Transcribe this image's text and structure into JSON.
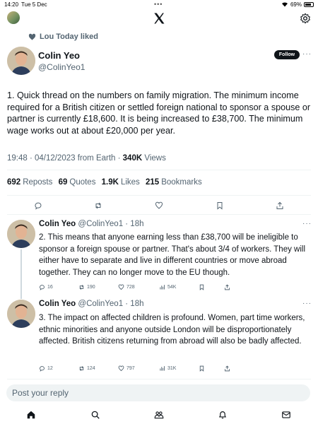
{
  "status_bar": {
    "time": "14:20",
    "date": "Tue 5 Dec",
    "battery": "69%"
  },
  "liked_by": "Lou Today liked",
  "main_tweet": {
    "author_name": "Colin Yeo",
    "handle": "@ColinYeo1",
    "follow_label": "Follow",
    "text": "1. Quick thread on the numbers on family migration. The minimum income required for a British citizen or settled foreign national to sponsor a spouse or partner is currently £18,600. It is being increased to £38,700. The minimum wage works out at about £20,000 per year.",
    "timestamp": "19:48 · 04/12/2023 from Earth · ",
    "views_count": "340K",
    "views_label": " Views",
    "stats": {
      "reposts_count": "692",
      "reposts_label": "Reposts",
      "quotes_count": "69",
      "quotes_label": "Quotes",
      "likes_count": "1.9K",
      "likes_label": "Likes",
      "bookmarks_count": "215",
      "bookmarks_label": "Bookmarks"
    }
  },
  "replies": [
    {
      "author_name": "Colin Yeo",
      "handle_time": "@ColinYeo1 · 18h",
      "text": "2. This means that anyone earning less than £38,700 will be ineligible to sponsor a foreign spouse or partner. That's about 3/4 of workers. They will either have to separate and live in different countries or move abroad together. They can no longer move to the EU though.",
      "replies": "16",
      "reposts": "190",
      "likes": "728",
      "views": "54K"
    },
    {
      "author_name": "Colin Yeo",
      "handle_time": "@ColinYeo1 · 18h",
      "text": "3. The impact on affected children is profound. Women, part time workers, ethnic minorities and anyone outside London will be disproportionately affected. British citizens returning from abroad will also be badly affected.",
      "replies": "12",
      "reposts": "124",
      "likes": "797",
      "views": "31K"
    }
  ],
  "reply_placeholder": "Post your reply",
  "icons": {
    "logo": "x-logo-icon",
    "settings": "gear-icon",
    "home": "home-icon",
    "search": "search-icon",
    "communities": "people-icon",
    "notifications": "bell-icon",
    "messages": "envelope-icon"
  },
  "colors": {
    "text": "#0f1419",
    "muted": "#536471",
    "divider": "#eff3f4"
  }
}
